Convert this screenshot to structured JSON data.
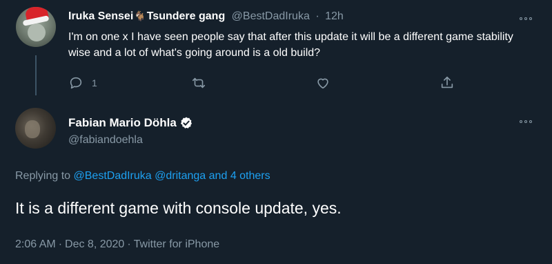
{
  "parent_tweet": {
    "display_name": "Iruka Sensei",
    "name_emoji": "🐐",
    "display_name_suffix": "Tsundere gang",
    "handle": "@BestDadIruka",
    "separator": "·",
    "time": "12h",
    "text": "I'm on one x I have seen people say that after this update it will be a different game stability wise and a lot of what's going around is a old build?",
    "reply_count": "1",
    "icons": [
      "reply-icon",
      "retweet-icon",
      "like-icon",
      "share-icon",
      "more-icon"
    ]
  },
  "main_tweet": {
    "display_name": "Fabian Mario Döhla",
    "verified": true,
    "handle": "@fabiandoehla",
    "replying_prefix": "Replying to",
    "replying_user_1": "@BestDadIruka",
    "replying_user_2": "@dritanga",
    "replying_and": "and",
    "replying_others": "4 others",
    "text": "It is a different game with console update, yes.",
    "time": "2:06 AM",
    "separator": "·",
    "date": "Dec 8, 2020",
    "source": "Twitter for iPhone"
  },
  "colors": {
    "background": "#15202b",
    "muted": "#8899a6",
    "link": "#1da1f2",
    "verified": "#ffffff"
  }
}
